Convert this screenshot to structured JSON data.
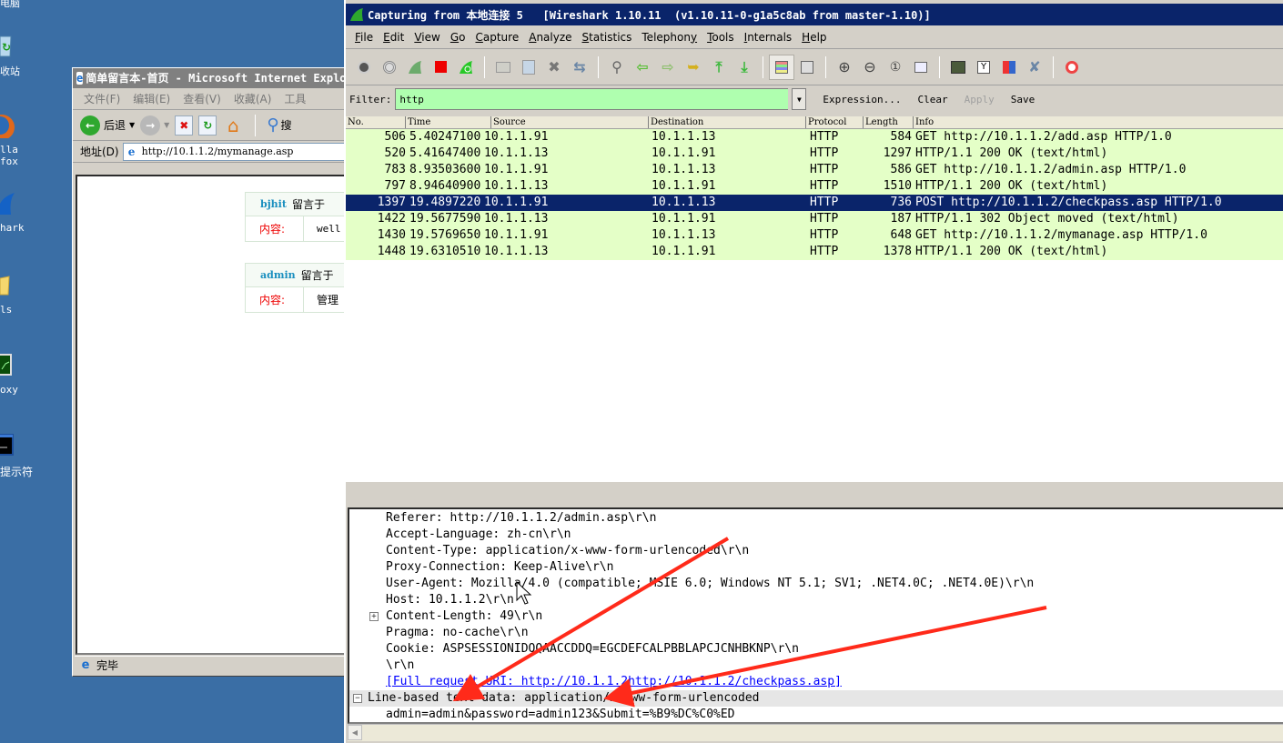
{
  "desktop": {
    "icons": [
      {
        "name": "my-computer",
        "label": "电脑"
      },
      {
        "name": "recycle-bin",
        "label": "收站"
      },
      {
        "name": "firefox",
        "label": "lla\nfox"
      },
      {
        "name": "wireshark",
        "label": "hark"
      },
      {
        "name": "tools-folder",
        "label": "ls"
      },
      {
        "name": "proxy",
        "label": "oxy"
      },
      {
        "name": "command-prompt",
        "label": "提示符"
      }
    ]
  },
  "ie": {
    "title": "简单留言本-首页 - Microsoft Internet Explorer",
    "menu": [
      "文件(F)",
      "编辑(E)",
      "查看(V)",
      "收藏(A)",
      "工具"
    ],
    "back_label": "后退",
    "search_label": "搜",
    "address_label": "地址(D)",
    "address_value": "http://10.1.1.2/mymanage.asp",
    "status": "完毕",
    "messages": [
      {
        "user": "bjhit",
        "posted_label": "留言于",
        "content_label": "内容:",
        "content": "well"
      },
      {
        "user": "admin",
        "posted_label": "留言于",
        "content_label": "内容:",
        "content": "管理"
      }
    ]
  },
  "wireshark": {
    "title": "Capturing from 本地连接 5   [Wireshark 1.10.11  (v1.10.11-0-g1a5c8ab from master-1.10)]",
    "menu": [
      {
        "label": "File",
        "accel": "F"
      },
      {
        "label": "Edit",
        "accel": "E"
      },
      {
        "label": "View",
        "accel": "V"
      },
      {
        "label": "Go",
        "accel": "G"
      },
      {
        "label": "Capture",
        "accel": "C"
      },
      {
        "label": "Analyze",
        "accel": "A"
      },
      {
        "label": "Statistics",
        "accel": "S"
      },
      {
        "label": "Telephony",
        "accel": "y"
      },
      {
        "label": "Tools",
        "accel": "T"
      },
      {
        "label": "Internals",
        "accel": "I"
      },
      {
        "label": "Help",
        "accel": "H"
      }
    ],
    "filter": {
      "label": "Filter:",
      "value": "http",
      "expression": "Expression...",
      "clear": "Clear",
      "apply": "Apply",
      "save": "Save",
      "valid_color": "#afffaf"
    },
    "columns": [
      "No.",
      "Time",
      "Source",
      "Destination",
      "Protocol",
      "Length",
      "Info"
    ],
    "packets": [
      {
        "no": "506",
        "time": "5.40247100",
        "src": "10.1.1.91",
        "dst": "10.1.1.13",
        "proto": "HTTP",
        "len": "584",
        "info": "GET http://10.1.1.2/add.asp HTTP/1.0",
        "selected": false
      },
      {
        "no": "520",
        "time": "5.41647400",
        "src": "10.1.1.13",
        "dst": "10.1.1.91",
        "proto": "HTTP",
        "len": "1297",
        "info": "HTTP/1.1 200 OK  (text/html)",
        "selected": false
      },
      {
        "no": "783",
        "time": "8.93503600",
        "src": "10.1.1.91",
        "dst": "10.1.1.13",
        "proto": "HTTP",
        "len": "586",
        "info": "GET http://10.1.1.2/admin.asp HTTP/1.0",
        "selected": false
      },
      {
        "no": "797",
        "time": "8.94640900",
        "src": "10.1.1.13",
        "dst": "10.1.1.91",
        "proto": "HTTP",
        "len": "1510",
        "info": "HTTP/1.1 200 OK  (text/html)",
        "selected": false
      },
      {
        "no": "1397",
        "time": "19.4897220",
        "src": "10.1.1.91",
        "dst": "10.1.1.13",
        "proto": "HTTP",
        "len": "736",
        "info": "POST http://10.1.1.2/checkpass.asp HTTP/1.0",
        "selected": true
      },
      {
        "no": "1422",
        "time": "19.5677590",
        "src": "10.1.1.13",
        "dst": "10.1.1.91",
        "proto": "HTTP",
        "len": "187",
        "info": "HTTP/1.1 302 Object moved  (text/html)",
        "selected": false
      },
      {
        "no": "1430",
        "time": "19.5769650",
        "src": "10.1.1.91",
        "dst": "10.1.1.13",
        "proto": "HTTP",
        "len": "648",
        "info": "GET http://10.1.1.2/mymanage.asp HTTP/1.0",
        "selected": false
      },
      {
        "no": "1448",
        "time": "19.6310510",
        "src": "10.1.1.13",
        "dst": "10.1.1.91",
        "proto": "HTTP",
        "len": "1378",
        "info": "HTTP/1.1 200 OK  (text/html)",
        "selected": false
      }
    ],
    "http_row_color": "#e4ffc7",
    "selected_row_color": "#0a246a",
    "details": [
      {
        "text": "Referer: http://10.1.1.2/admin.asp\\r\\n",
        "indent": 1
      },
      {
        "text": "Accept-Language: zh-cn\\r\\n",
        "indent": 1
      },
      {
        "text": "Content-Type: application/x-www-form-urlencoded\\r\\n",
        "indent": 1
      },
      {
        "text": "Proxy-Connection: Keep-Alive\\r\\n",
        "indent": 1
      },
      {
        "text": "User-Agent: Mozilla/4.0 (compatible; MSIE 6.0; Windows NT 5.1; SV1; .NET4.0C; .NET4.0E)\\r\\n",
        "indent": 1
      },
      {
        "text": "Host: 10.1.1.2\\r\\n",
        "indent": 1
      },
      {
        "text": "Content-Length: 49\\r\\n",
        "indent": 1,
        "toggle": "+"
      },
      {
        "text": "Pragma: no-cache\\r\\n",
        "indent": 1
      },
      {
        "text": "Cookie: ASPSESSIONIDQQAACCDDQ=EGCDEFCALPBBLAPCJCNHBKNP\\r\\n",
        "indent": 1
      },
      {
        "text": "\\r\\n",
        "indent": 1
      },
      {
        "text": "[Full request URI: http://10.1.1.2http://10.1.1.2/checkpass.asp]",
        "indent": 1,
        "link": true
      },
      {
        "text": "Line-based text data: application/x-www-form-urlencoded",
        "indent": 0,
        "toggle": "-",
        "highlight": true
      },
      {
        "text": "admin=admin&password=admin123&Submit=%B9%DC%C0%ED",
        "indent": 1
      }
    ]
  },
  "annotations": {
    "arrow_color": "#ff2a1a",
    "arrows": [
      {
        "points_to": "Line-based text data"
      },
      {
        "points_to": "application/x-www-form-urlencoded"
      }
    ]
  }
}
